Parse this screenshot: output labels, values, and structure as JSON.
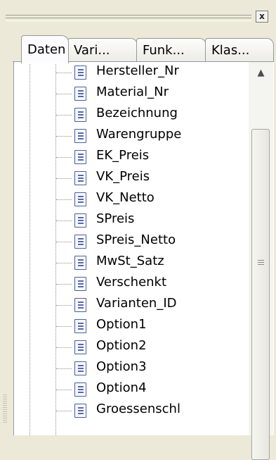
{
  "panel": {
    "close_label": "x"
  },
  "tabs": [
    {
      "label": "Daten",
      "active": true
    },
    {
      "label": "Vari..."
    },
    {
      "label": "Funk..."
    },
    {
      "label": "Klas..."
    }
  ],
  "tree": {
    "items": [
      {
        "label": "Hersteller_Nr"
      },
      {
        "label": "Material_Nr"
      },
      {
        "label": "Bezeichnung"
      },
      {
        "label": "Warengruppe"
      },
      {
        "label": "EK_Preis"
      },
      {
        "label": "VK_Preis"
      },
      {
        "label": "VK_Netto"
      },
      {
        "label": "SPreis"
      },
      {
        "label": "SPreis_Netto"
      },
      {
        "label": "MwSt_Satz"
      },
      {
        "label": "Verschenkt"
      },
      {
        "label": "Varianten_ID"
      },
      {
        "label": "Option1"
      },
      {
        "label": "Option2"
      },
      {
        "label": "Option3"
      },
      {
        "label": "Option4"
      },
      {
        "label": "Groessenschl"
      }
    ]
  },
  "icons": {
    "item_icon": "document-field-icon",
    "scroll_up_icon": "triangle-up-icon",
    "scroll_grip_icon": "grip-lines-icon"
  }
}
